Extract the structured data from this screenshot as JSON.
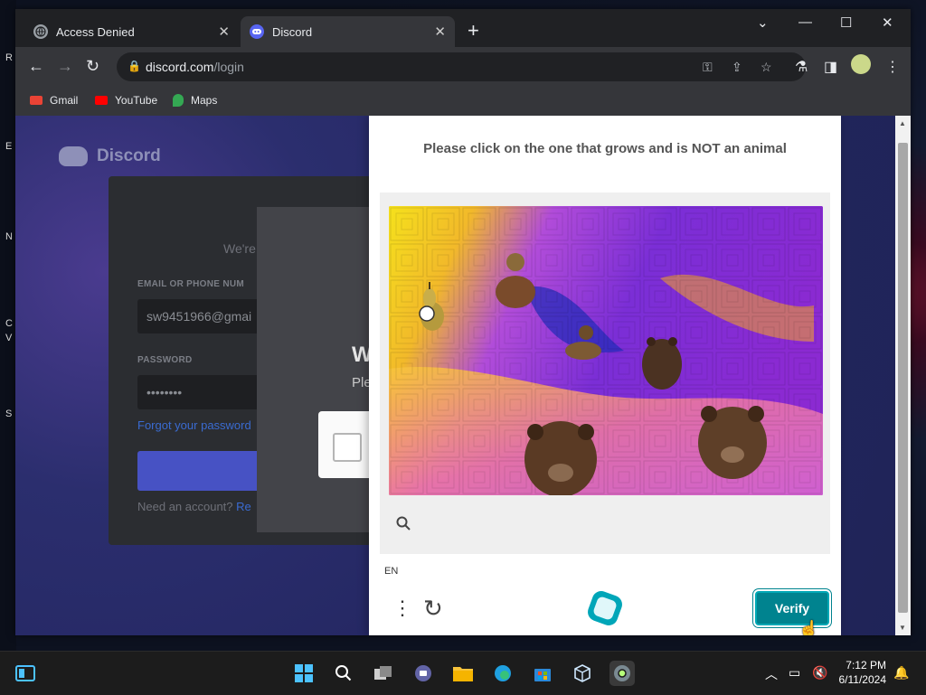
{
  "desktop": {
    "left_labels": [
      "R",
      "E",
      "N",
      "C",
      "V",
      "S"
    ]
  },
  "browser": {
    "tabs": [
      {
        "title": "Access Denied",
        "favicon": "globe-icon"
      },
      {
        "title": "Discord",
        "favicon": "discord-icon"
      }
    ],
    "address": {
      "host": "discord.com",
      "path": "/login"
    },
    "bookmarks": [
      {
        "label": "Gmail",
        "icon": "gmail-icon"
      },
      {
        "label": "YouTube",
        "icon": "youtube-icon"
      },
      {
        "label": "Maps",
        "icon": "maps-icon"
      }
    ]
  },
  "discord": {
    "brand": "Discord",
    "welcome": "We're",
    "email_label": "EMAIL OR PHONE NUM",
    "email_value": "sw9451966@gmai",
    "password_label": "PASSWORD",
    "password_value": "••••••••",
    "forgot": "Forgot your password",
    "need_account": "Need an account?",
    "register_link": "Re",
    "modal_title": "W",
    "modal_sub": "Ple"
  },
  "captcha": {
    "prompt": "Please click on the one that grows and is NOT an animal",
    "lang": "EN",
    "verify": "Verify",
    "accent_color": "#00838f"
  },
  "taskbar": {
    "time": "7:12 PM",
    "date": "6/11/2024"
  }
}
